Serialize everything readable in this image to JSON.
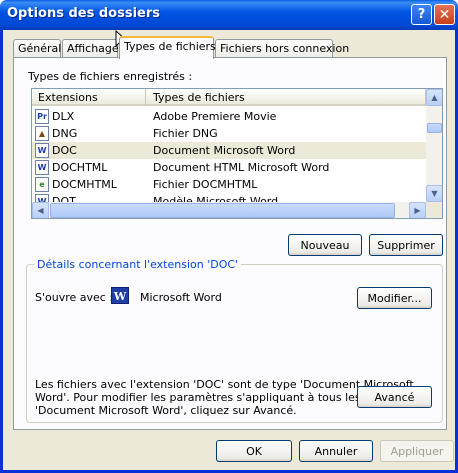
{
  "window": {
    "title": "Options des dossiers",
    "help_glyph": "?",
    "close_glyph": "✕"
  },
  "tabs": [
    {
      "label": "Général"
    },
    {
      "label": "Affichage"
    },
    {
      "label": "Types de fichiers",
      "active": true
    },
    {
      "label": "Fichiers hors connexion"
    }
  ],
  "file_types": {
    "section_label": "Types de fichiers enregistrés :",
    "columns": [
      "Extensions",
      "Types de fichiers"
    ],
    "rows": [
      {
        "ext": "DLX",
        "type": "Adobe Premiere Movie",
        "icon": "premiere-file-icon"
      },
      {
        "ext": "DNG",
        "type": "Fichier DNG",
        "icon": "image-file-icon"
      },
      {
        "ext": "DOC",
        "type": "Document Microsoft Word",
        "icon": "word-file-icon",
        "selected": true
      },
      {
        "ext": "DOCHTML",
        "type": "Document HTML Microsoft Word",
        "icon": "word-file-icon"
      },
      {
        "ext": "DOCMHTML",
        "type": "Fichier DOCMHTML",
        "icon": "web-file-icon"
      },
      {
        "ext": "DOT",
        "type": "Modèle Microsoft Word",
        "icon": "word-file-icon"
      }
    ],
    "new_button": "Nouveau",
    "delete_button": "Supprimer"
  },
  "details": {
    "group_title": "Détails concernant l'extension 'DOC'",
    "opens_with_label": "S'ouvre avec :",
    "app_name": "Microsoft Word",
    "app_icon_glyph": "W",
    "modify_button": "Modifier...",
    "description": "Les fichiers avec l'extension 'DOC' sont de type 'Document Microsoft Word'. Pour modifier les paramètres s'appliquant à tous les fichiers 'Document Microsoft Word', cliquez sur Avancé.",
    "advanced_button": "Avancé"
  },
  "footer": {
    "ok_button": "OK",
    "cancel_button": "Annuler",
    "apply_button": "Appliquer"
  },
  "colors": {
    "titlebar": "#0054e3",
    "window_bg": "#ece9d8",
    "panel_bg": "#fcfcfe",
    "group_title": "#0046d5",
    "active_tab_accent": "#f6b83b"
  }
}
